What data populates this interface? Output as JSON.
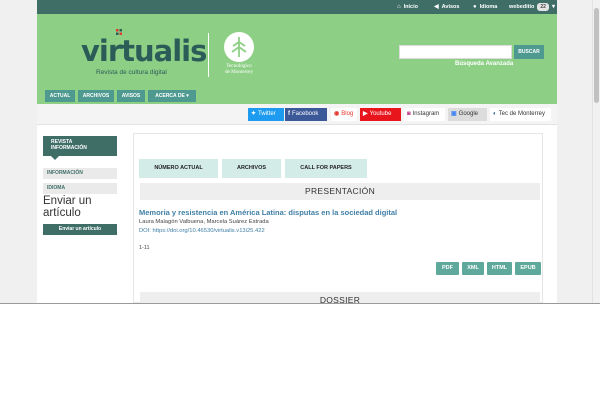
{
  "topbar": {
    "home": "Inicio",
    "notices": "Avisos",
    "language": "Idioma",
    "user": "webeditio",
    "user_count": "22",
    "home_icon": "home-icon",
    "notices_icon": "megaphone-icon",
    "language_icon": "globe-icon"
  },
  "header": {
    "logo": "virtualis",
    "tagline": "Revista de cultura digital",
    "partner_line1": "Tecnológico",
    "partner_line2": "de Monterrey",
    "search_placeholder": "",
    "search_button": "BUSCAR",
    "advanced_search": "Búsqueda Avanzada"
  },
  "nav": {
    "items": [
      "ACTUAL",
      "ARCHIVOS",
      "AVISOS",
      "ACERCA DE"
    ]
  },
  "social": {
    "twitter": "Twitter",
    "facebook": "Facebook",
    "blog": "Blog",
    "youtube": "Youtube",
    "instagram": "Instagram",
    "google": "Google",
    "tec": "Tec de Monterrey"
  },
  "sidebar": {
    "title_line1": "REVISTA",
    "title_line2": "INFORMACIÓN",
    "items": [
      "INFORMACIÓN",
      "IDIOMA"
    ],
    "submit_line1": "Enviar un",
    "submit_line2": "artículo",
    "submit_button": "Enviar un artículo"
  },
  "main": {
    "tabs": [
      "NÚMERO ACTUAL",
      "ARCHIVOS",
      "CALL FOR PAPERS"
    ],
    "section1": "PRESENTACIÓN",
    "article": {
      "title": "Memoria y resistencia en América Latina: disputas en la sociedad digital",
      "authors": "Laura Malagón Valbuena, Marcela Suárez Estrada",
      "doi": "DOI: https://doi.org/10.46530/virtualis.v13i25.422",
      "pages": "1-11",
      "galleys": [
        "PDF",
        "XML",
        "HTML",
        "EPUB"
      ]
    },
    "section2": "DOSSIER"
  },
  "colors": {
    "header_green": "#8ecf86",
    "dark_teal": "#3f6e67",
    "button_teal": "#5fa89c",
    "link_blue": "#3f7fa6"
  }
}
